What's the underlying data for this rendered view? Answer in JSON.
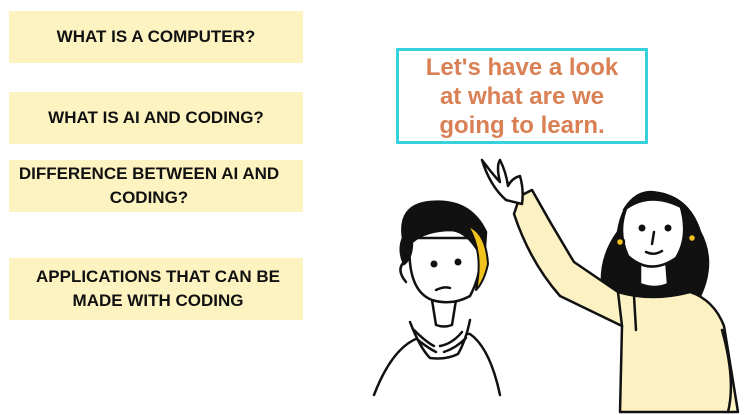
{
  "topics": [
    {
      "label": "WHAT IS A COMPUTER?"
    },
    {
      "label": "WHAT IS AI AND CODING?"
    },
    {
      "label": "DIFFERENCE BETWEEN AI AND CODING?"
    },
    {
      "label": "APPLICATIONS THAT CAN BE MADE WITH CODING"
    }
  ],
  "callout": {
    "line1": "Let's have a look",
    "line2": "at what are we",
    "line3": "going to learn."
  },
  "colors": {
    "topic_bg": "#fdf3c1",
    "callout_border": "#36d1dc",
    "callout_text": "#d98055",
    "sweater": "#fbf1c3",
    "hair_highlight": "#f2c31c"
  }
}
